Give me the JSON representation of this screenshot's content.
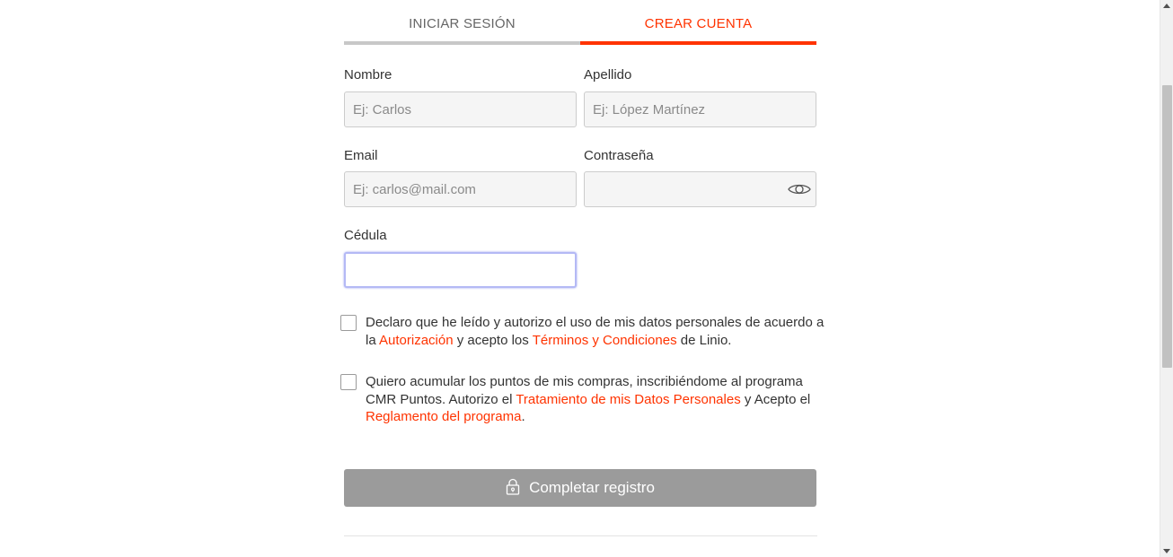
{
  "tabs": {
    "login_label": "INICIAR SESIÓN",
    "register_label": "CREAR CUENTA"
  },
  "form": {
    "nombre": {
      "label": "Nombre",
      "placeholder": "Ej: Carlos",
      "value": ""
    },
    "apellido": {
      "label": "Apellido",
      "placeholder": "Ej: López Martínez",
      "value": ""
    },
    "email": {
      "label": "Email",
      "placeholder": "Ej: carlos@mail.com",
      "value": ""
    },
    "password": {
      "label": "Contraseña",
      "placeholder": "",
      "value": "",
      "icon": "eye-icon"
    },
    "cedula": {
      "label": "Cédula",
      "placeholder": "",
      "value": ""
    }
  },
  "consent1": {
    "checked": false,
    "text_1": "Declaro que he leído y autorizo el uso de mis datos personales de acuerdo a la ",
    "link_autorizacion": "Autorización",
    "text_2": " y acepto los ",
    "link_terminos": "Términos y Condiciones",
    "text_3": " de Linio."
  },
  "consent2": {
    "checked": false,
    "text_1": "Quiero acumular los puntos de mis compras, inscribiéndome al programa CMR Puntos. Autorizo el ",
    "link_tratamiento": "Tratamiento de mis Datos Personales",
    "text_2": " y Acepto el ",
    "link_reglamento": "Reglamento del programa",
    "text_3": "."
  },
  "submit": {
    "label": "Completar registro",
    "icon": "lock-icon"
  },
  "colors": {
    "accent": "#ff3300",
    "button_disabled": "#9b9b9b",
    "input_bg": "#f5f5f5",
    "focus_ring": "#b4b9f5"
  }
}
